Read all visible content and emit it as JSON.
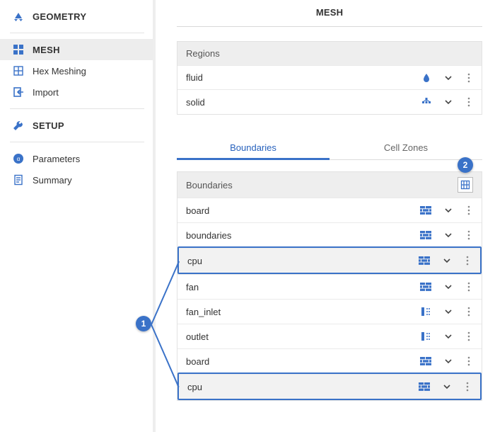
{
  "sidebar": {
    "sections": {
      "geometry": {
        "label": "GEOMETRY"
      },
      "mesh": {
        "label": "MESH",
        "items": [
          {
            "label": "Hex Meshing"
          },
          {
            "label": "Import"
          }
        ]
      },
      "setup": {
        "label": "SETUP",
        "items": [
          {
            "label": "Parameters"
          },
          {
            "label": "Summary"
          }
        ]
      }
    }
  },
  "page": {
    "title": "MESH"
  },
  "regions": {
    "header": "Regions",
    "rows": [
      {
        "name": "fluid",
        "type": "fluid"
      },
      {
        "name": "solid",
        "type": "solid"
      }
    ]
  },
  "tabs": {
    "items": [
      {
        "key": "boundaries",
        "label": "Boundaries",
        "active": true
      },
      {
        "key": "cellzones",
        "label": "Cell Zones",
        "active": false
      }
    ]
  },
  "boundaries": {
    "header": "Boundaries",
    "rows": [
      {
        "name": "board",
        "type": "wall",
        "selected": false
      },
      {
        "name": "boundaries",
        "type": "wall",
        "selected": false
      },
      {
        "name": "cpu",
        "type": "wall",
        "selected": true
      },
      {
        "name": "fan",
        "type": "wall",
        "selected": false
      },
      {
        "name": "fan_inlet",
        "type": "patch",
        "selected": false
      },
      {
        "name": "outlet",
        "type": "patch",
        "selected": false
      },
      {
        "name": "board",
        "type": "wall",
        "selected": false
      },
      {
        "name": "cpu",
        "type": "wall",
        "selected": true
      }
    ]
  },
  "callouts": {
    "one": "1",
    "two": "2"
  },
  "colors": {
    "accent": "#3a72c8"
  }
}
